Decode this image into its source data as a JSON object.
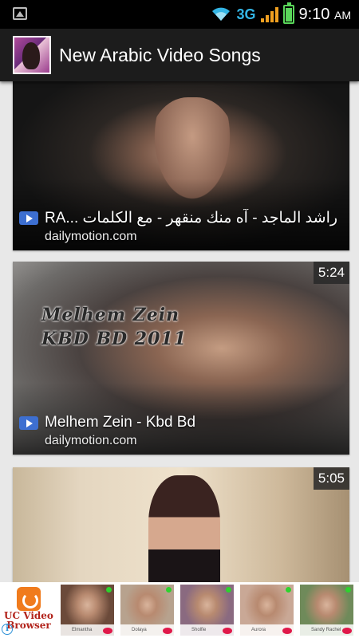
{
  "status_bar": {
    "network": "3G",
    "time": "9:10",
    "am_pm": "AM"
  },
  "app_bar": {
    "title": "New Arabic Video Songs",
    "icon": "app-logo-singer"
  },
  "videos": [
    {
      "title": "RA... راشد الماجد - آه منك منقهر - مع الكلمات",
      "source": "dailymotion.com",
      "duration": ""
    },
    {
      "title": "Melhem Zein - Kbd Bd",
      "source": "dailymotion.com",
      "duration": "5:24",
      "overlay_line1": "Melhem Zein",
      "overlay_line2": "KBD BD 2011"
    },
    {
      "title": "",
      "source": "",
      "duration": "5:05"
    }
  ],
  "ad_banner": {
    "app_name_line1": "UC Video",
    "app_name_line2": "Browser",
    "profiles": [
      {
        "name": "Elmantha",
        "color": "#6b4a3a"
      },
      {
        "name": "Dolaya",
        "color": "#b7a28e"
      },
      {
        "name": "Sholfie",
        "color": "#8a6a80"
      },
      {
        "name": "Aurora",
        "color": "#c9a896"
      },
      {
        "name": "Sandy Rachel",
        "color": "#6f8a5a"
      }
    ]
  },
  "colors": {
    "status_bar": "#000000",
    "action_bar": "#1c1c1c",
    "feed_background": "#e8e8e8",
    "play_icon": "#3d6fd1",
    "network_type": "#33b5e5"
  }
}
